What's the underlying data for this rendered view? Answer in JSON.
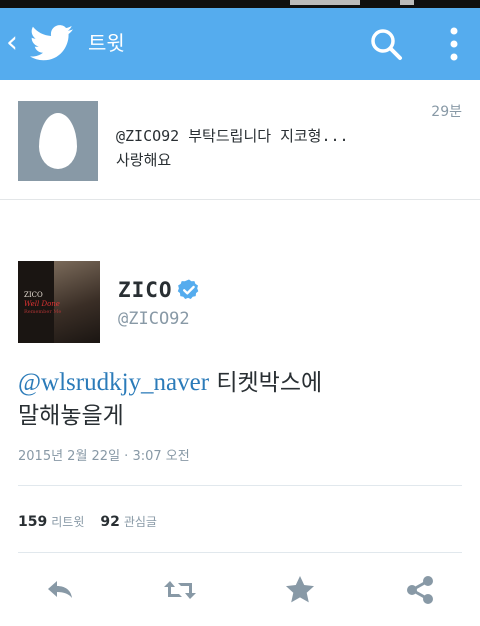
{
  "appbar": {
    "title": "트윗",
    "back_icon": "chevron-left-icon",
    "logo_icon": "twitter-bird-icon",
    "search_icon": "search-icon",
    "more_icon": "more-vertical-icon",
    "color": "#55acee"
  },
  "reply": {
    "avatar": "default-egg-avatar",
    "text_line1": "@ZICO92 부탁드립니다 지코형...",
    "text_line2": "사랑해요",
    "time": "29분"
  },
  "tweet": {
    "display_name": "ZICO",
    "verified_icon": "verified-badge-icon",
    "handle": "@ZICO92",
    "avatar_text": [
      "ZICO",
      "Well Done",
      "Remember Me"
    ],
    "mention": "@wlsrudkjy_naver",
    "text_after_mention": "티켓박스에",
    "text_line2": "말해놓을게",
    "date": "2015년 2월 22일 · 3:07 오전",
    "retweets_count": "159",
    "retweets_label": "리트윗",
    "favorites_count": "92",
    "favorites_label": "관심글"
  },
  "actions": {
    "reply_icon": "reply-icon",
    "retweet_icon": "retweet-icon",
    "favorite_icon": "star-icon",
    "share_icon": "share-icon"
  },
  "colors": {
    "link": "#2b7bb9",
    "muted": "#8899a6",
    "text": "#292f33"
  }
}
